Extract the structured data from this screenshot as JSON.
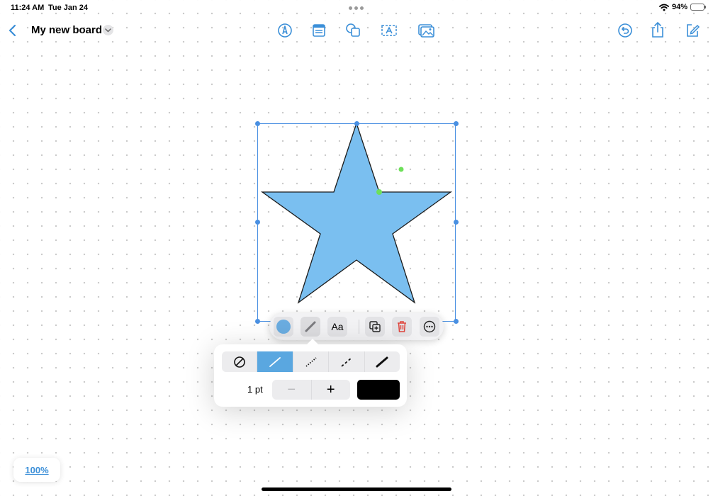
{
  "status_bar": {
    "time": "11:24 AM",
    "date": "Tue Jan 24",
    "battery": "94%"
  },
  "header": {
    "title": "My new board",
    "tools": [
      "pen-icon",
      "sticky-note-icon",
      "shapes-icon",
      "text-box-icon",
      "media-icon"
    ],
    "right_actions": [
      "undo-icon",
      "share-icon",
      "compose-icon"
    ]
  },
  "canvas": {
    "shape": {
      "type": "star",
      "fill_color": "#7abff0",
      "stroke_color": "#1b1b1b",
      "selection_color": "#4a90e2",
      "handle_color": "#4a90e2",
      "control_point_color": "#6ee05a"
    }
  },
  "context_menu": {
    "fill_swatch_color": "#6aace0",
    "text_style_label": "Aa",
    "actions": [
      "fill-color-button",
      "stroke-style-button",
      "text-style-button",
      "duplicate-button",
      "delete-button",
      "more-button"
    ],
    "delete_color": "#e0443c"
  },
  "stroke_popover": {
    "styles": [
      "none",
      "solid",
      "dotted",
      "dashed",
      "brush"
    ],
    "selected_style": "solid",
    "width_label": "1 pt",
    "decrement_label": "−",
    "increment_label": "+",
    "stroke_color": "#000000"
  },
  "zoom": {
    "label": "100%"
  },
  "accent_color": "#3b8fd8"
}
